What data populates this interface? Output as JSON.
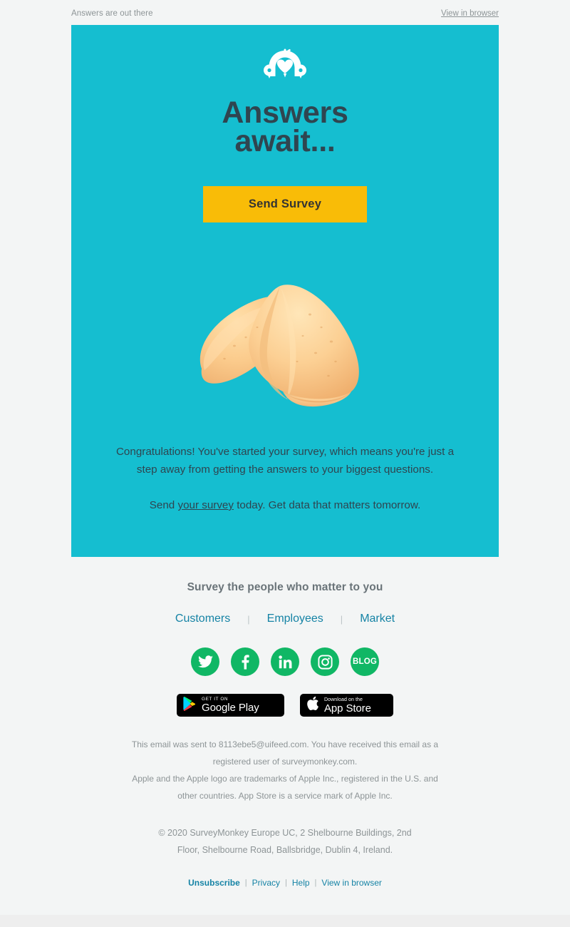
{
  "preheader": {
    "text": "Answers are out there",
    "view_in_browser": "View in browser"
  },
  "hero": {
    "logo_name": "surveymonkey-logo",
    "title_line1": "Answers",
    "title_line2": "await...",
    "cta_label": "Send Survey",
    "image_name": "fortune-cookies-photo",
    "paragraph1": "Congratulations! You've started your survey, which means you're just a step away from getting the answers to your biggest questions.",
    "paragraph2_before": "Send ",
    "paragraph2_link": "your survey",
    "paragraph2_after": " today. Get data that matters tomorrow.",
    "background_color": "#15bed0",
    "cta_color": "#f9bc07",
    "text_color": "#2f4550"
  },
  "footer": {
    "heading": "Survey the people who matter to you",
    "nav": [
      {
        "label": "Customers"
      },
      {
        "label": "Employees"
      },
      {
        "label": "Market"
      }
    ],
    "nav_separator": "|",
    "link_color": "#1583a5",
    "social": [
      {
        "name": "twitter-icon",
        "label": "Twitter"
      },
      {
        "name": "facebook-icon",
        "label": "Facebook"
      },
      {
        "name": "linkedin-icon",
        "label": "LinkedIn"
      },
      {
        "name": "instagram-icon",
        "label": "Instagram"
      },
      {
        "name": "blog-icon",
        "label": "BLOG"
      }
    ],
    "social_color": "#10b765",
    "badges": {
      "google_play": {
        "small": "GET IT ON",
        "big": "Google Play"
      },
      "app_store": {
        "small": "Download on the",
        "big": "App Store"
      }
    },
    "legal_line1": "This email was sent to 8113ebe5@uifeed.com. You have received this email as a",
    "legal_line2": "registered user of surveymonkey.com.",
    "legal_line3": "Apple and the Apple logo are trademarks of Apple Inc., registered in the U.S. and",
    "legal_line4": "other countries. App Store is a service mark of Apple Inc.",
    "copyright_line1": "© 2020 SurveyMonkey Europe UC, 2 Shelbourne Buildings, 2nd",
    "copyright_line2": "Floor, Shelbourne Road, Ballsbridge, Dublin 4, Ireland.",
    "bottom_links": [
      {
        "label": "Unsubscribe",
        "bold": true
      },
      {
        "label": "Privacy",
        "bold": false
      },
      {
        "label": "Help",
        "bold": false
      },
      {
        "label": "View in browser",
        "bold": false
      }
    ],
    "bottom_separator": "|"
  }
}
